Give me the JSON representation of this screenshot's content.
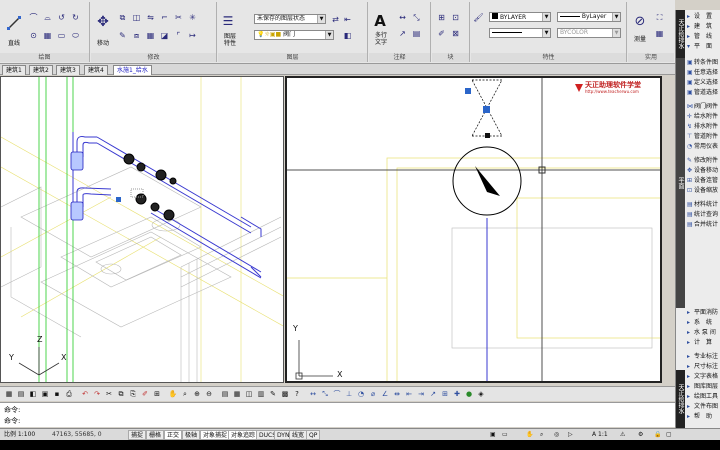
{
  "ribbon": {
    "panels": [
      {
        "label": "绘图"
      },
      {
        "label": "修改"
      },
      {
        "label": "图层"
      },
      {
        "label": "注释"
      },
      {
        "label": "块"
      },
      {
        "label": "特性"
      },
      {
        "label": "实用"
      }
    ],
    "draw_big": "直线",
    "move_big": "移动",
    "layer_props": "图层\n特性",
    "layer_state_value": "未保存的图层状态",
    "layer_current_value": "阀门",
    "multiline_text": "多行\n文字",
    "prop_layer": "BYLAYER",
    "prop_linetype": "ByLayer",
    "prop_color": "BYCOLOR",
    "measure_label": "测量"
  },
  "tabs": [
    "建筑1",
    "建筑2",
    "建筑3",
    "建筑4",
    "水施1_给水"
  ],
  "active_tab": 4,
  "watermark": {
    "title": "天正助理软件学堂",
    "url": "http://www.teacherwu.com"
  },
  "ucs": {
    "x": "X",
    "y": "Y",
    "z": "Z"
  },
  "sidebar": {
    "header1": "天正给排水",
    "header2": "平面",
    "group1": [
      "设　置",
      "建　筑",
      "管　线",
      "平　面"
    ],
    "group2": [
      "转条件图",
      "任意选择",
      "定义选择",
      "管道选择",
      "阀门阀件",
      "给水附件",
      "排水附件",
      "管道附件",
      "常用仪表",
      "修改附件",
      "设备移动",
      "设备连管",
      "设备缩放",
      "材料统计",
      "统计查询",
      "合并统计"
    ],
    "group3": [
      "平面消防",
      "系　统",
      "水 泵 间",
      "计　算"
    ],
    "group4": [
      "专业标注",
      "尺寸标注",
      "文字表格",
      "图库图层",
      "绘图工具",
      "文件布图",
      "帮　助"
    ],
    "footer": "天正给排水"
  },
  "command": {
    "line1": "命令:",
    "line2": "命令:"
  },
  "status": {
    "scale": "比例 1:100",
    "coords": "47163,  55685,  0",
    "toggles": [
      "捕捉",
      "栅格",
      "正交",
      "极轴",
      "对象捕捉",
      "对象追踪",
      "DUCS",
      "DYN",
      "线宽",
      "QP"
    ],
    "anno_scale": "A 1:1"
  },
  "colors": {
    "canvas": "#ffffff",
    "pipe_blue": "#3a3ad0",
    "grid_yellow": "#e8e070",
    "green_line": "#22cc22"
  }
}
